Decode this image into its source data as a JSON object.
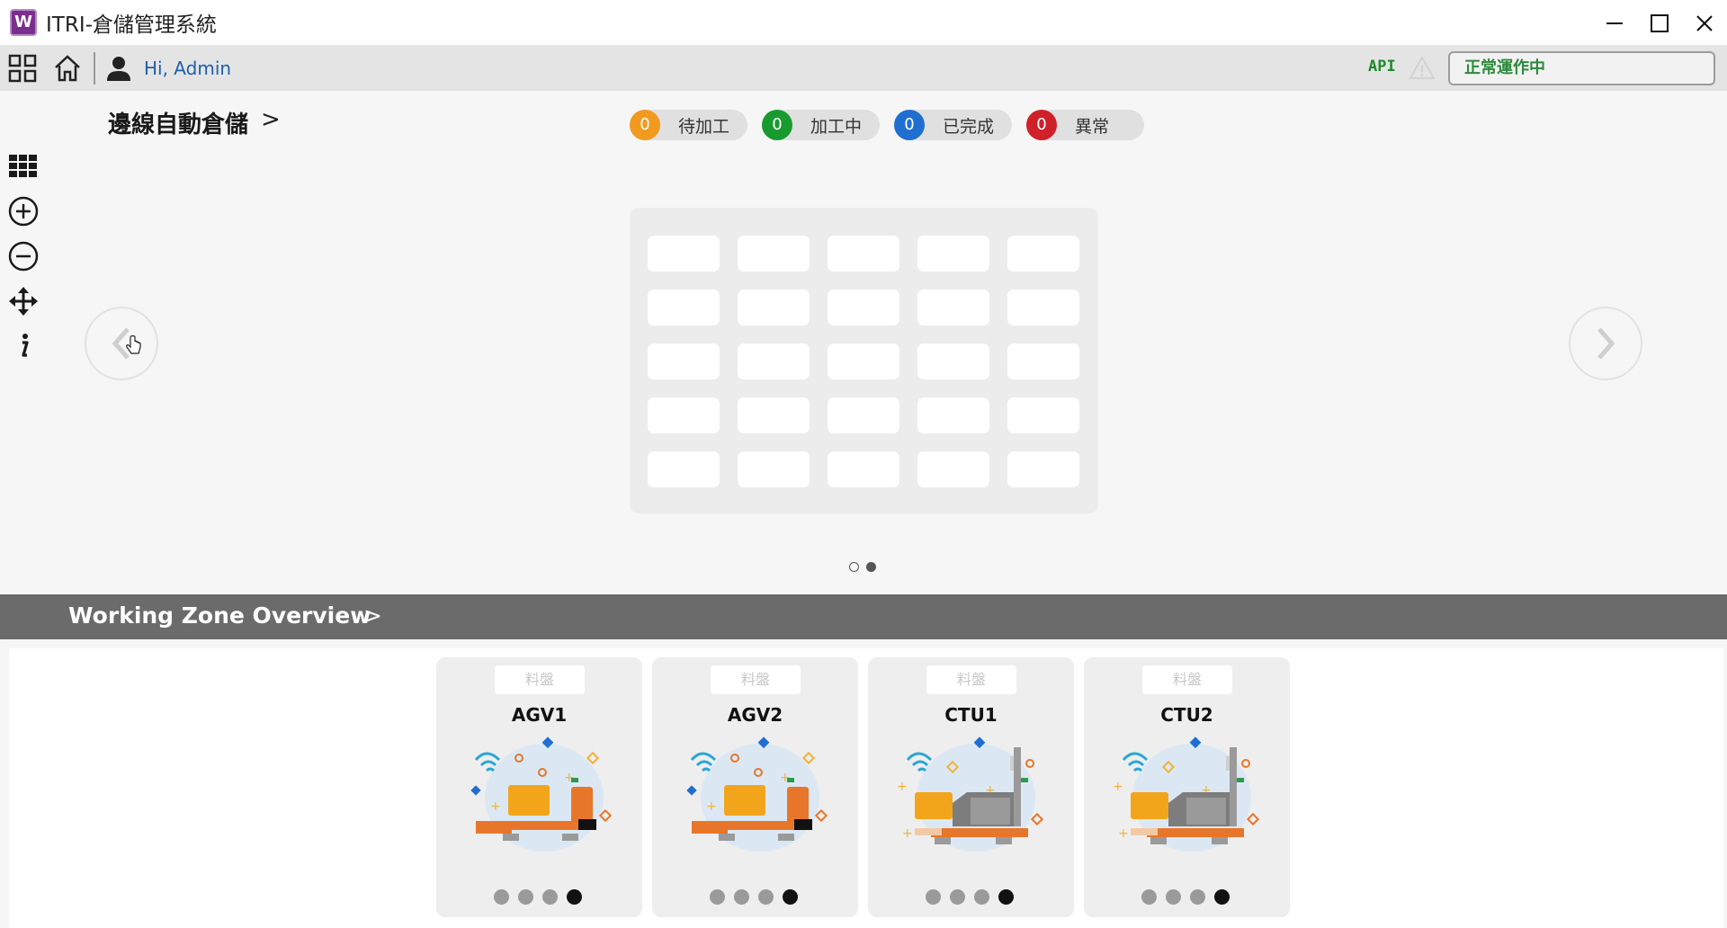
{
  "window": {
    "logo_letter": "W",
    "title": "ITRI-倉儲管理系統"
  },
  "toolbar": {
    "greeting": "Hi, Admin",
    "api_label": "API",
    "status_value": "正常運作中"
  },
  "warehouse": {
    "title": "邊線自動倉儲",
    "arrow": ">",
    "status_pills": [
      {
        "count": "0",
        "label": "待加工",
        "color": "#f29a1f"
      },
      {
        "count": "0",
        "label": "加工中",
        "color": "#179b2e"
      },
      {
        "count": "0",
        "label": "已完成",
        "color": "#1f6fd1"
      },
      {
        "count": "0",
        "label": "異常",
        "color": "#d0202a"
      }
    ],
    "rack": {
      "rows": 5,
      "cols": 5
    },
    "pager": {
      "pages": 2,
      "active_page": 2
    }
  },
  "zone": {
    "title": "Working Zone Overview",
    "arrow": ">",
    "cards": [
      {
        "tag": "料盤",
        "name": "AGV1",
        "kind": "agv",
        "indicators": [
          false,
          false,
          false,
          true
        ]
      },
      {
        "tag": "料盤",
        "name": "AGV2",
        "kind": "agv",
        "indicators": [
          false,
          false,
          false,
          true
        ]
      },
      {
        "tag": "料盤",
        "name": "CTU1",
        "kind": "ctu",
        "indicators": [
          false,
          false,
          false,
          true
        ]
      },
      {
        "tag": "料盤",
        "name": "CTU2",
        "kind": "ctu",
        "indicators": [
          false,
          false,
          false,
          true
        ]
      }
    ]
  },
  "icons": {
    "toolbar": [
      "grid-apps-icon",
      "home-icon",
      "user-icon",
      "warning-icon"
    ],
    "sidebar": [
      "grid-view-icon",
      "zoom-in-icon",
      "zoom-out-icon",
      "move-icon",
      "info-icon"
    ],
    "window": [
      "minimize-icon",
      "maximize-icon",
      "close-icon"
    ]
  }
}
